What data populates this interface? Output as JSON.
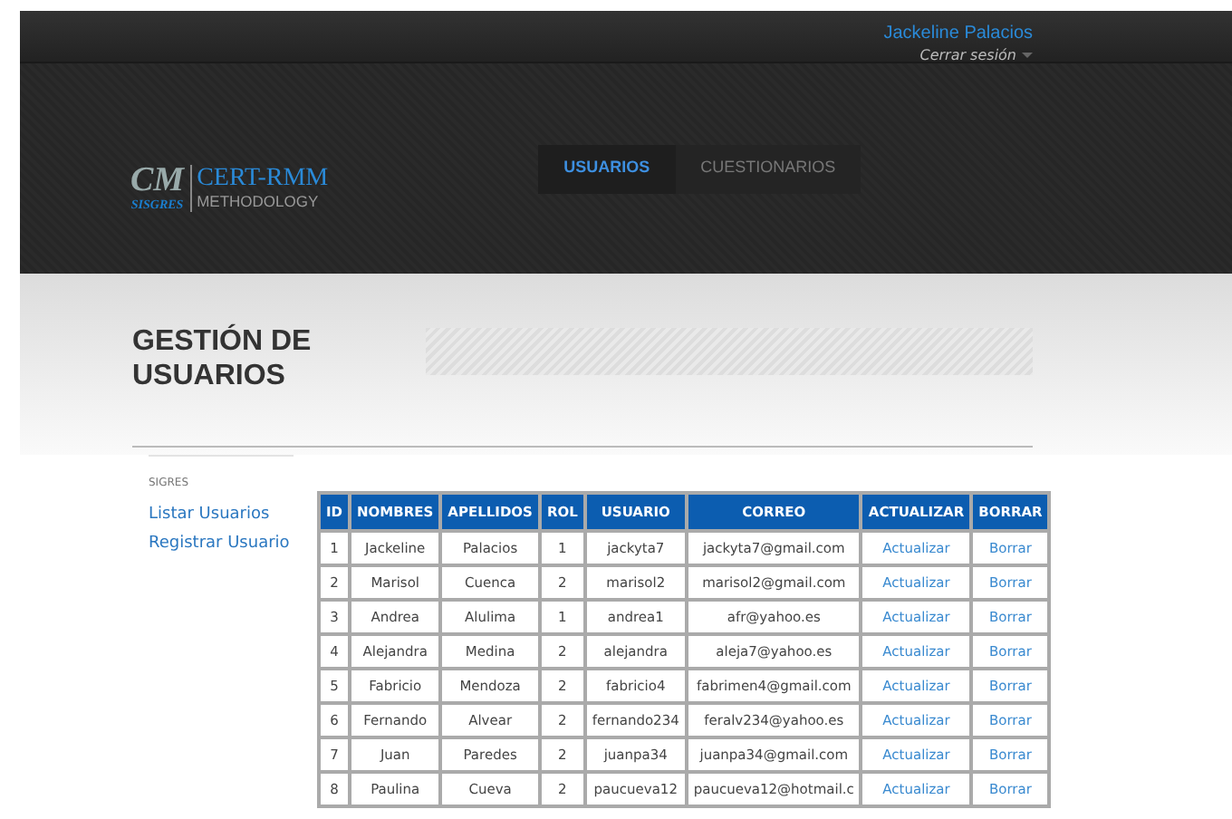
{
  "user": {
    "name": "Jackeline Palacios",
    "logout": "Cerrar sesión"
  },
  "logo": {
    "mark": "CM",
    "mark_sub": "SISGRES",
    "title": "CERT-RMM",
    "subtitle": "METHODOLOGY"
  },
  "tabs": [
    {
      "label": "USUARIOS",
      "selected": true
    },
    {
      "label": "CUESTIONARIOS",
      "selected": false
    }
  ],
  "page_title": "GESTIÓN DE USUARIOS",
  "sidebar": {
    "heading": "SIGRES",
    "items": [
      "Listar Usuarios",
      "Registrar Usuario"
    ]
  },
  "table": {
    "columns": [
      "ID",
      "NOMBRES",
      "APELLIDOS",
      "ROL",
      "USUARIO",
      "CORREO",
      "ACTUALIZAR",
      "BORRAR"
    ],
    "rows": [
      [
        "1",
        "Jackeline",
        "Palacios",
        "1",
        "jackyta7",
        "jackyta7@gmail.com",
        "Actualizar",
        "Borrar"
      ],
      [
        "2",
        "Marisol",
        "Cuenca",
        "2",
        "marisol2",
        "marisol2@gmail.com",
        "Actualizar",
        "Borrar"
      ],
      [
        "3",
        "Andrea",
        "Alulima",
        "1",
        "andrea1",
        "afr@yahoo.es",
        "Actualizar",
        "Borrar"
      ],
      [
        "4",
        "Alejandra",
        "Medina",
        "2",
        "alejandra",
        "aleja7@yahoo.es",
        "Actualizar",
        "Borrar"
      ],
      [
        "5",
        "Fabricio",
        "Mendoza",
        "2",
        "fabricio4",
        "fabrimen4@gmail.com",
        "Actualizar",
        "Borrar"
      ],
      [
        "6",
        "Fernando",
        "Alvear",
        "2",
        "fernando234",
        "feralv234@yahoo.es",
        "Actualizar",
        "Borrar"
      ],
      [
        "7",
        "Juan",
        "Paredes",
        "2",
        "juanpa34",
        "juanpa34@gmail.com",
        "Actualizar",
        "Borrar"
      ],
      [
        "8",
        "Paulina",
        "Cueva",
        "2",
        "paucueva12",
        "paucueva12@hotmail.c",
        "Actualizar",
        "Borrar"
      ]
    ]
  }
}
